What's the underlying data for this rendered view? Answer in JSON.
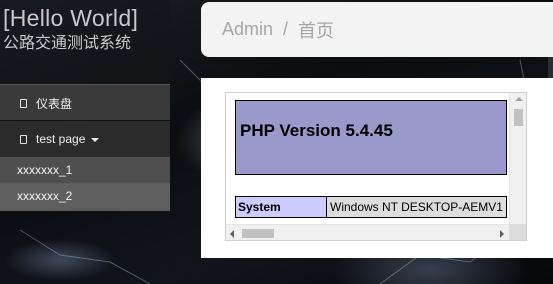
{
  "brand": {
    "title": "[Hello World]",
    "subtitle": "公路交通测试系统"
  },
  "sidebar": {
    "items": [
      {
        "label": "仪表盘",
        "icon": "dashboard-icon"
      },
      {
        "label": "test page",
        "icon": "page-icon",
        "expanded": true,
        "children": [
          {
            "label": "xxxxxxx_1"
          },
          {
            "label": "xxxxxxx_2"
          }
        ]
      }
    ]
  },
  "breadcrumb": {
    "parent": "Admin",
    "separator": "/",
    "current": "首页"
  },
  "phpinfo": {
    "title": "PHP Version 5.4.45",
    "rows": [
      {
        "key": "System",
        "value": "Windows NT DESKTOP-AEMV1"
      }
    ]
  },
  "colors": {
    "sidebar_active": "#3a3a3a",
    "submenu_bg": "#5a5a5a",
    "php_header": "#9999cc",
    "php_key": "#ccccff",
    "php_value": "#dddddd"
  }
}
